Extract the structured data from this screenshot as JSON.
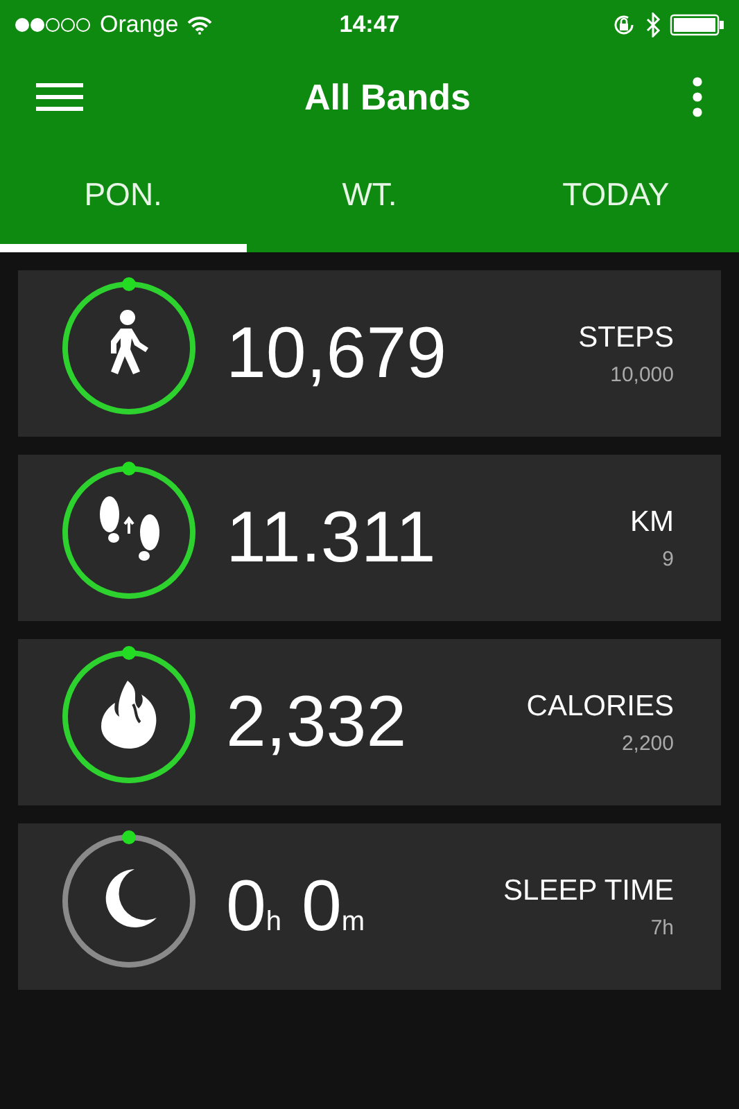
{
  "status_bar": {
    "carrier": "Orange",
    "time": "14:47"
  },
  "app_bar": {
    "title": "All Bands"
  },
  "tabs": [
    {
      "label": "PON.",
      "selected": true
    },
    {
      "label": "WT.",
      "selected": false
    },
    {
      "label": "TODAY",
      "selected": false
    }
  ],
  "cards": [
    {
      "kind": "walk",
      "value": "10,679",
      "label": "STEPS",
      "goal": "10,000",
      "goal_met": true
    },
    {
      "kind": "footsteps",
      "value": "11.311",
      "label": "KM",
      "goal": "9",
      "goal_met": true
    },
    {
      "kind": "flame",
      "value": "2,332",
      "label": "CALORIES",
      "goal": "2,200",
      "goal_met": true
    },
    {
      "kind": "moon",
      "value": "0$_{h}$ 0$_{m}$",
      "label": "SLEEP TIME",
      "goal": "7h",
      "goal_met": false
    }
  ]
}
